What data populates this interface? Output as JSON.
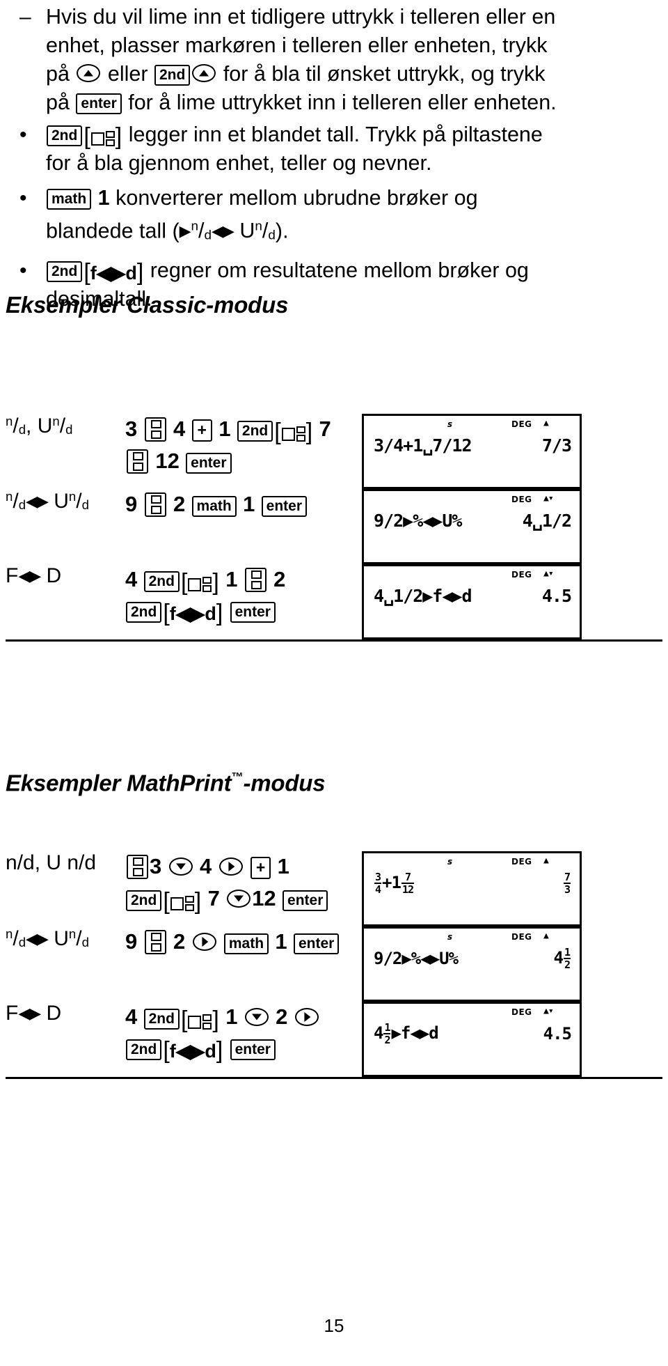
{
  "bullets": [
    {
      "marker": "–",
      "segments": [
        "Hvis du vil lime inn et tidligere uttrykk i telleren eller en enhet, plasser markøren i telleren eller enheten, trykk på ",
        " eller ",
        " ",
        " for å bla til ønsket uttrykk, og trykk på ",
        " for å lime uttrykket inn i telleren eller enheten."
      ],
      "keys": [
        "up-arrow",
        "2nd",
        "up-arrow",
        "enter"
      ]
    },
    {
      "marker": "•",
      "key1": "2nd",
      "key2": "mixed-number",
      "text": "legger inn et blandet tall. Trykk på piltastene for å bla gjennom enhet, teller og nevner."
    },
    {
      "marker": "•",
      "key1": "math",
      "arg": "1",
      "text": "konverterer mellom ubrudne brøker og blandede tall (",
      "text_end": ")."
    },
    {
      "marker": "•",
      "key1": "2nd",
      "key2": "f◀▶d",
      "text": "regner om resultatene mellom brøker og desimaltall."
    }
  ],
  "labels": {
    "key_2nd": "2nd",
    "key_enter": "enter",
    "key_math": "math",
    "key_plus": "+",
    "key_fd": "f◀▶d",
    "math_arg": "1"
  },
  "sections": {
    "classic": {
      "heading": "Eksempler Classic-modus",
      "rows": [
        {
          "label_html": "n/d_Und",
          "label_kind": "nd-und",
          "keys": [
            "3",
            "frac",
            "4",
            "plus",
            "1",
            "2nd",
            "mixed",
            "7",
            "frac",
            "12",
            "enter"
          ],
          "screen": {
            "indicator_s": "s",
            "indicator_deg": "DEG",
            "arrow": "up",
            "expr": "3/4+1␣7/12",
            "result": "7/3"
          }
        },
        {
          "label_html": "n/d◀▶ U n/d",
          "label_kind": "nd-arrows-und",
          "keys": [
            "9",
            "frac",
            "2",
            "math",
            "1",
            "enter"
          ],
          "screen": {
            "indicator_s": "",
            "indicator_deg": "DEG",
            "arrow": "updown",
            "expr": "9/2▶%◀▶U%",
            "result": "4␣1/2"
          }
        },
        {
          "label_html": "F◀▶ D",
          "label_kind": "fd",
          "keys": [
            "4",
            "2nd",
            "mixed",
            "1",
            "frac",
            "2",
            "2nd",
            "fd",
            "enter"
          ],
          "screen": {
            "indicator_s": "",
            "indicator_deg": "DEG",
            "arrow": "updown",
            "expr": "4␣1/2▶f◀▶d",
            "result": "4.5"
          }
        }
      ]
    },
    "mathprint": {
      "heading": "Eksempler MathPrint",
      "heading_tm": "™",
      "heading_tail": "-modus",
      "rows": [
        {
          "label_html": "n/d, U n/d",
          "label_kind": "plain",
          "keys": [
            "frac",
            "3",
            "down",
            "4",
            "right",
            "plus",
            "1",
            "2nd",
            "mixed",
            "7",
            "down",
            "12",
            "enter"
          ],
          "screen": {
            "indicator_s": "s",
            "indicator_deg": "DEG",
            "arrow": "up",
            "expr_parts": [
              {
                "num": "3",
                "den": "4"
              },
              "+1",
              {
                "num": "7",
                "den": "12"
              }
            ],
            "result_num": "7",
            "result_den": "3"
          }
        },
        {
          "label_html": "n/d◀▶ U n/d",
          "label_kind": "nd-arrows-und",
          "keys": [
            "9",
            "frac",
            "2",
            "right",
            "math",
            "1",
            "enter"
          ],
          "screen": {
            "indicator_s": "s",
            "indicator_deg": "DEG",
            "arrow": "up",
            "expr_raw": "9/2▶%◀▶U%",
            "result_whole": "4",
            "result_num": "1",
            "result_den": "2"
          }
        },
        {
          "label_html": "F◀▶ D",
          "label_kind": "fd",
          "keys": [
            "4",
            "2nd",
            "mixed",
            "1",
            "down",
            "2",
            "right",
            "2nd",
            "fd",
            "enter"
          ],
          "screen": {
            "indicator_s": "",
            "indicator_deg": "DEG",
            "arrow": "updown",
            "result": "4.5",
            "expr_whole": "4",
            "expr_num": "1",
            "expr_den": "2",
            "expr_tail": "▶f◀▶d"
          }
        }
      ]
    }
  },
  "page_number": "15"
}
